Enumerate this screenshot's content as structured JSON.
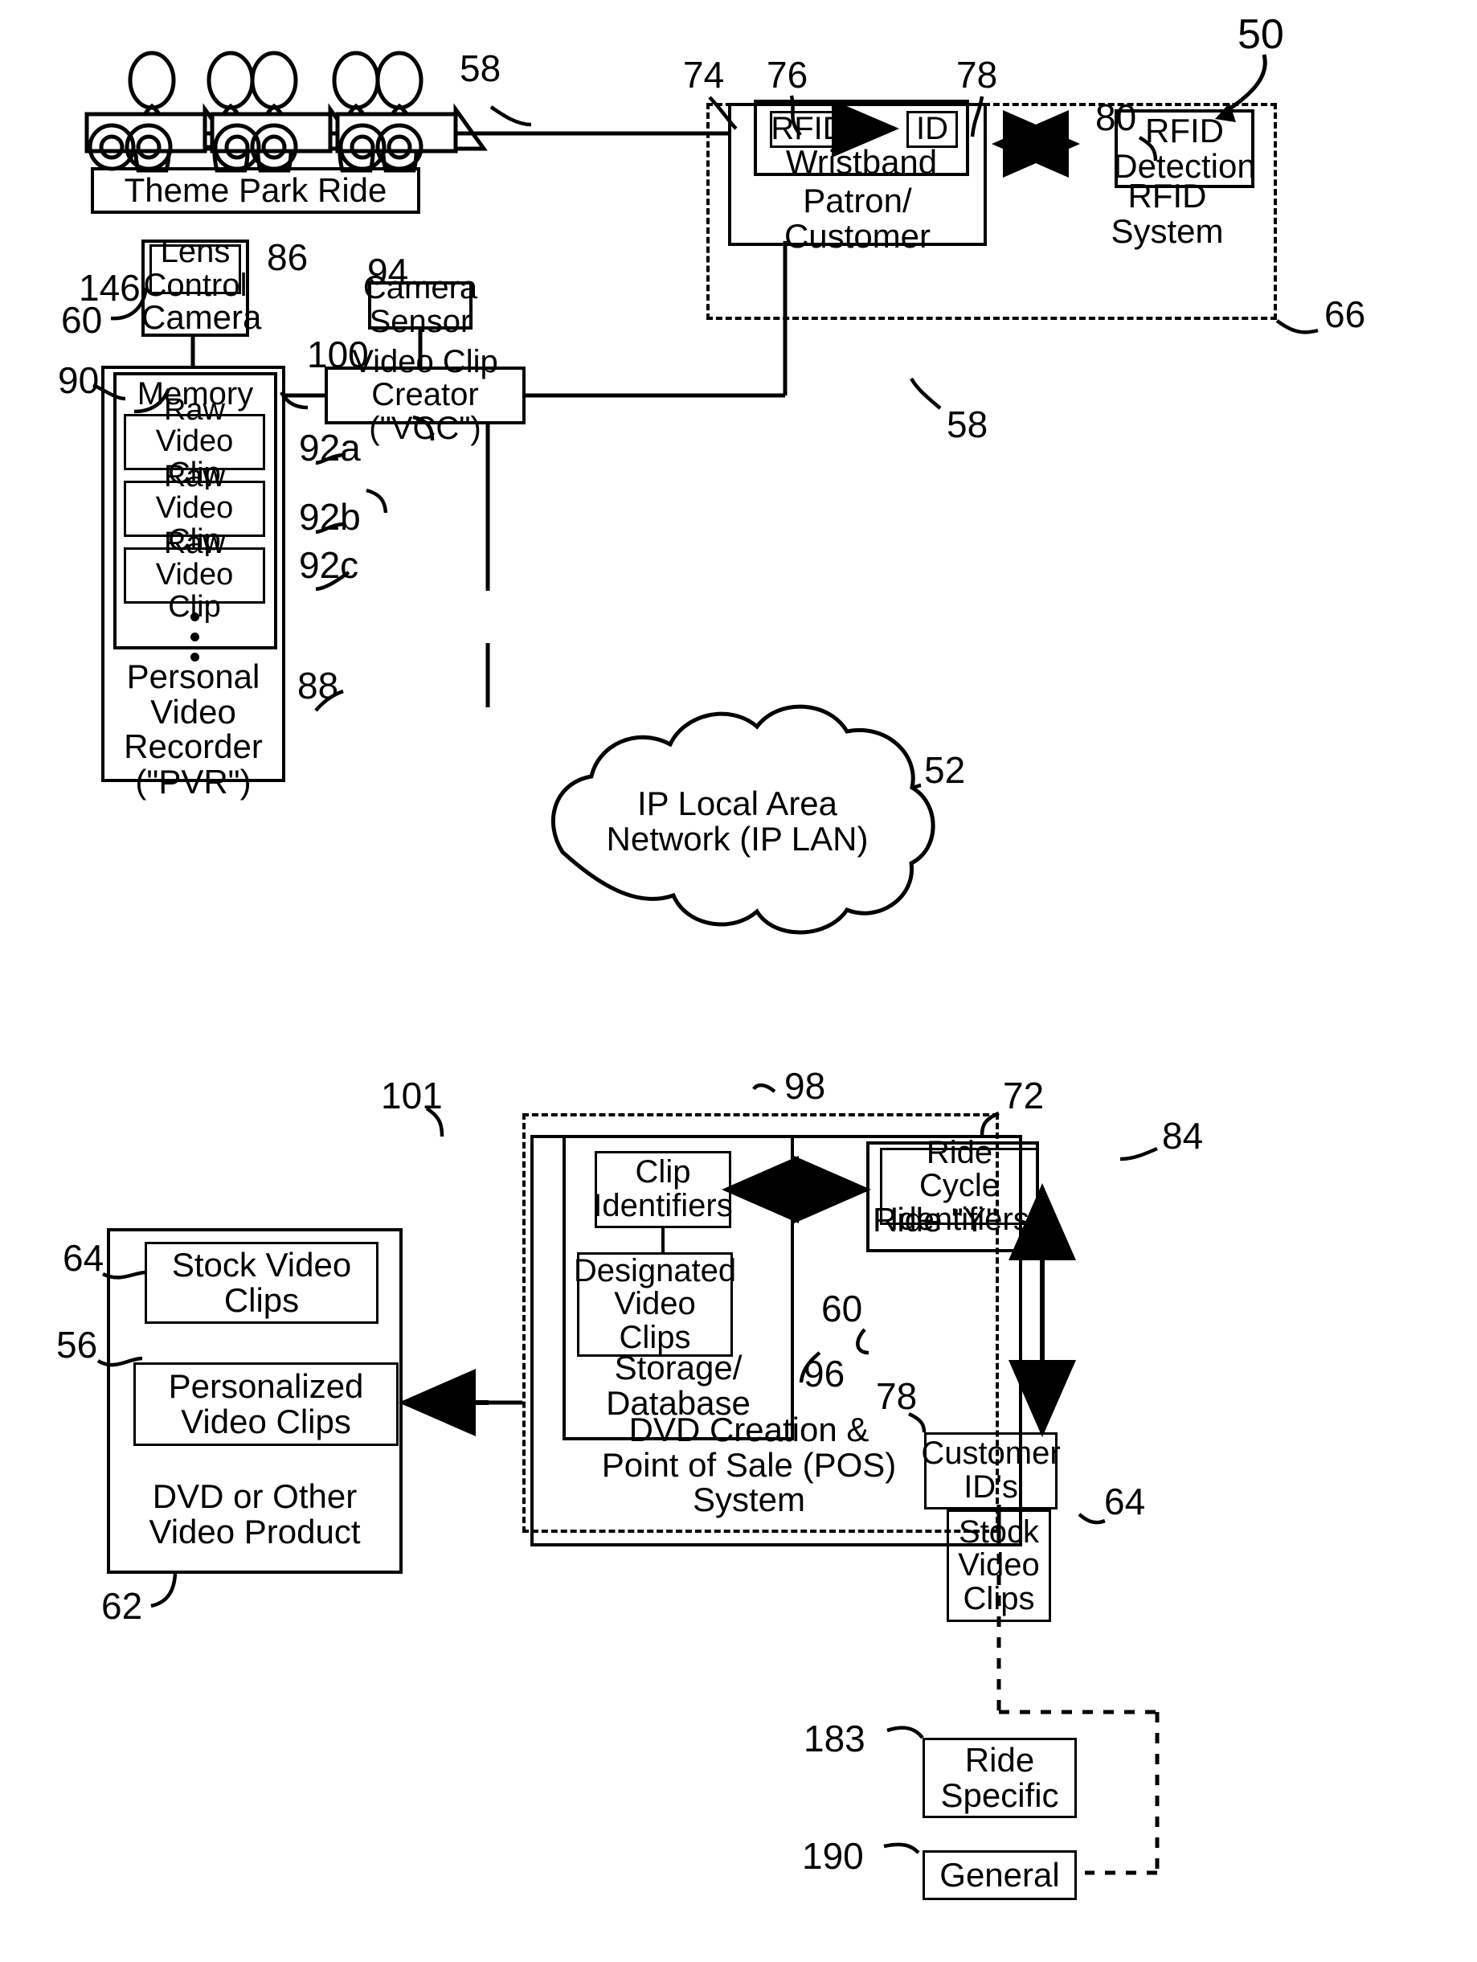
{
  "figure": {
    "type": "patent-block-diagram",
    "system_ref": "50"
  },
  "ride": {
    "label": "Theme Park Ride",
    "ref_ride": "60",
    "ref_patron_car": "58",
    "cars": 3
  },
  "patron": {
    "label": "Patron/\nCustomer",
    "ref": "58",
    "ref_leader": "74",
    "wristband": {
      "label": "Wristband",
      "rfid": "RFID",
      "rfid_ref": "76",
      "id": "ID",
      "id_ref": "78"
    }
  },
  "rfid_system": {
    "label": "RFID\nSystem",
    "ref": "66",
    "detection": {
      "label": "RFID\nDetection",
      "ref": "80"
    }
  },
  "camera": {
    "label": "Camera",
    "ref": "86",
    "lens_control": {
      "label": "Lens\nControl",
      "ref": "146"
    }
  },
  "camera_sensor": {
    "label": "Camera\nSensor",
    "ref": "94"
  },
  "vcc": {
    "label": "Video Clip\nCreator (\"VCC\")",
    "ref": "100"
  },
  "pvr": {
    "label": "Personal\nVideo\nRecorder\n(\"PVR\")",
    "ref": "88",
    "ref_outer": "90",
    "memory": {
      "label": "Memory",
      "clips": [
        {
          "label": "Raw Video\nClip",
          "ref": "92a"
        },
        {
          "label": "Raw Video\nClip",
          "ref": "92b"
        },
        {
          "label": "Raw Video\nClip",
          "ref": "92c"
        }
      ]
    }
  },
  "network": {
    "label": "IP Local Area\nNetwork (IP LAN)",
    "ref": "52"
  },
  "pos": {
    "label": "DVD Creation &\nPoint of Sale (POS)\nSystem",
    "ref": "72",
    "storage": {
      "label": "Storage/\nDatabase",
      "ref": "101",
      "clip_identifiers": {
        "label": "Clip\nIdentifiers",
        "ref": "98"
      },
      "designated_video_clips": {
        "label": "Designated\nVideo\nClips",
        "ref": "96"
      }
    },
    "ride_y": {
      "label": "Ride \"Y\"",
      "ref": "60",
      "ride_cycle_identifiers": {
        "label": "Ride Cycle\nIdentifiers",
        "ref": "84"
      }
    },
    "customer_ids": {
      "label": "Customer\nID's",
      "ref": "78"
    },
    "stock_video_clips": {
      "label": "Stock\nVideo\nClips",
      "ref": "64"
    }
  },
  "dvd_product": {
    "label": "DVD or Other\nVideo Product",
    "ref": "62",
    "stock_video_clips": {
      "label": "Stock Video\nClips",
      "ref": "64"
    },
    "personalized_video_clips": {
      "label": "Personalized\nVideo Clips",
      "ref": "56"
    }
  },
  "ride_specific": {
    "label": "Ride\nSpecific",
    "ref": "183"
  },
  "general": {
    "label": "General",
    "ref": "190"
  }
}
